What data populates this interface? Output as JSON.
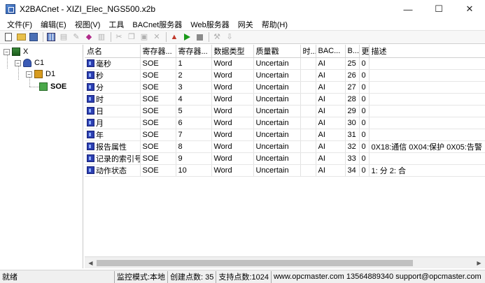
{
  "window": {
    "title": "X2BACnet - XIZI_Elec_NGS500.x2b",
    "minimize": "—",
    "maximize": "☐",
    "close": "✕"
  },
  "menu": [
    "文件(F)",
    "编辑(E)",
    "视图(V)",
    "工具",
    "BACnet服务器",
    "Web服务器",
    "网关",
    "帮助(H)"
  ],
  "toolbar": {
    "icons": [
      "new-icon",
      "open-icon",
      "save-icon",
      "grid-icon",
      "add-device-icon",
      "edit-icon",
      "add-point-icon",
      "delete-icon",
      "cut-icon",
      "copy-icon",
      "paste-icon",
      "remove-icon",
      "import-icon",
      "run-icon",
      "stop-icon",
      "tool-icon",
      "export-icon"
    ]
  },
  "tree": {
    "root": "X",
    "channel": "C1",
    "device": "D1",
    "group": "SOE",
    "expand_minus": "−"
  },
  "table": {
    "columns": [
      "点名",
      "寄存器...",
      "寄存器...",
      "数据类型",
      "质量戳",
      "时...",
      "BAC...",
      "B...",
      "更...",
      "描述"
    ],
    "rows": [
      [
        "毫秒",
        "SOE",
        "1",
        "Word",
        "Uncertain",
        "",
        "AI",
        "25",
        "0",
        ""
      ],
      [
        "秒",
        "SOE",
        "2",
        "Word",
        "Uncertain",
        "",
        "AI",
        "26",
        "0",
        ""
      ],
      [
        "分",
        "SOE",
        "3",
        "Word",
        "Uncertain",
        "",
        "AI",
        "27",
        "0",
        ""
      ],
      [
        "时",
        "SOE",
        "4",
        "Word",
        "Uncertain",
        "",
        "AI",
        "28",
        "0",
        ""
      ],
      [
        "日",
        "SOE",
        "5",
        "Word",
        "Uncertain",
        "",
        "AI",
        "29",
        "0",
        ""
      ],
      [
        "月",
        "SOE",
        "6",
        "Word",
        "Uncertain",
        "",
        "AI",
        "30",
        "0",
        ""
      ],
      [
        "年",
        "SOE",
        "7",
        "Word",
        "Uncertain",
        "",
        "AI",
        "31",
        "0",
        ""
      ],
      [
        "报告属性",
        "SOE",
        "8",
        "Word",
        "Uncertain",
        "",
        "AI",
        "32",
        "0",
        "0X18:通信  0X04:保护  0X05:告警"
      ],
      [
        "记录的索引号",
        "SOE",
        "9",
        "Word",
        "Uncertain",
        "",
        "AI",
        "33",
        "0",
        ""
      ],
      [
        "动作状态",
        "SOE",
        "10",
        "Word",
        "Uncertain",
        "",
        "AI",
        "34",
        "0",
        "1: 分  2: 合"
      ]
    ]
  },
  "scrollbar": {
    "left_arrow": "◀",
    "right_arrow": "▶"
  },
  "status": {
    "ready": "就绪",
    "mode": "监控模式:本地",
    "created": "创建点数: 35",
    "supported": "支持点数:1024",
    "contact": "www.opcmaster.com 13564889340 support@opcmaster.com"
  }
}
